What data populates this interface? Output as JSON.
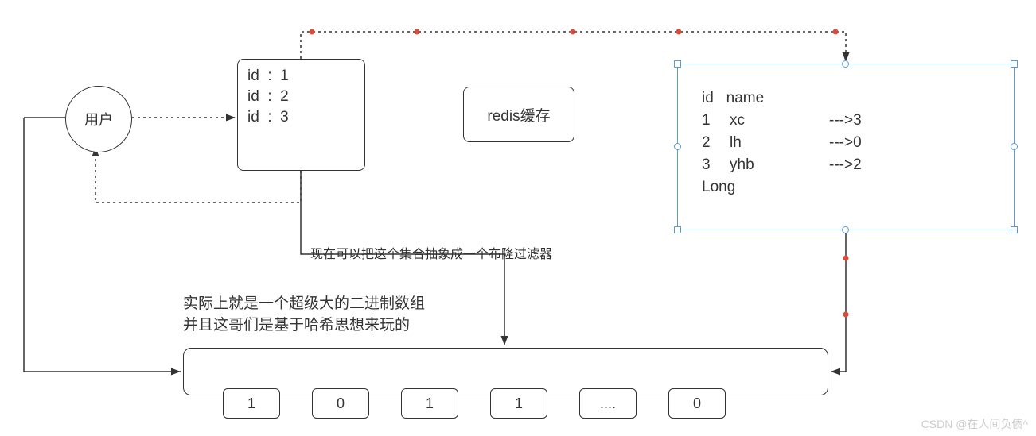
{
  "user_node": {
    "label": "用户"
  },
  "id_list_box": {
    "lines": [
      "id  :  1",
      "id  :  2",
      "id  :  3"
    ]
  },
  "redis_box": {
    "label": "redis缓存"
  },
  "db_box": {
    "header": "id   name",
    "rows": [
      {
        "id": "1",
        "name": "xc",
        "hash": "--->3"
      },
      {
        "id": "2",
        "name": "lh",
        "hash": "--->0"
      },
      {
        "id": "3",
        "name": "yhb",
        "hash": "--->2"
      },
      {
        "id": "",
        "name": "Long",
        "hash": ""
      }
    ]
  },
  "annotation1": "现在可以把这个集合抽象成一个布隆过滤器",
  "annotation2": "实际上就是一个超级大的二进制数组\n并且这哥们是基于哈希思想来玩的",
  "bit_array": [
    "1",
    "0",
    "1",
    "1",
    "....",
    "0"
  ],
  "watermark": "CSDN @在人间负债^"
}
